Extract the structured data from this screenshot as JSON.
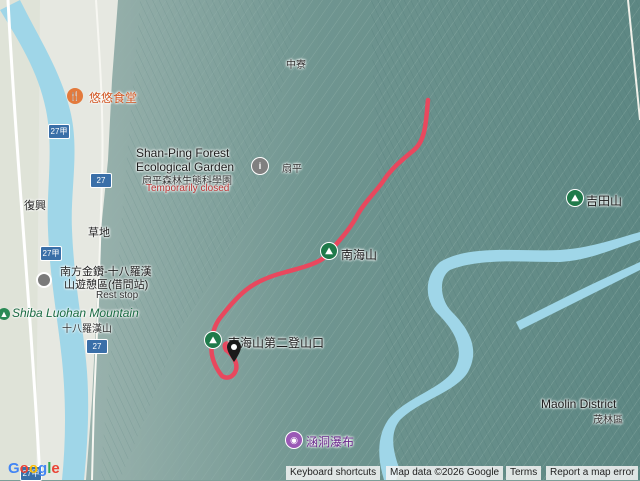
{
  "map": {
    "labels": {
      "youyou_restaurant": "悠悠食堂",
      "shanping_en_1": "Shan-Ping Forest",
      "shanping_en_2": "Ecological Garden",
      "shanping_zh": "扇平森林生態科學園",
      "shanping_closed": "Temporarily closed",
      "shanping_pin": "扇平",
      "zhongliao": "中寮",
      "nanfeng_zh_1": "南方金鑽-十八羅漢",
      "nanfeng_zh_2": "山遊憩區(借問站)",
      "rest_stop": "Rest stop",
      "shiba_luohan_en": "Shiba Luohan Mountain",
      "shiba_luohan_zh": "十八羅漢山",
      "fuxing": "復興",
      "caodi": "草地",
      "peak_nanhai": "南海山",
      "trailhead": "南海山第二登山口",
      "jitian": "吉田山",
      "handong_falls": "涵洞瀑布",
      "maolin_en": "Maolin District",
      "maolin_zh": "茂林區",
      "route_27a": "27甲",
      "route_27": "27"
    },
    "colors": {
      "track": "#e8485e",
      "river": "#9fd6e8",
      "terrain": "#7e9e98",
      "lowland": "#e6e8e1"
    },
    "icons": [
      "restaurant-icon",
      "info-icon",
      "camera-icon",
      "hiking-icon",
      "location-pin-icon"
    ]
  },
  "footer": {
    "keyboard_shortcuts": "Keyboard shortcuts",
    "map_data": "Map data ©2026 Google",
    "terms": "Terms",
    "report": "Report a map error",
    "google": "Google"
  }
}
